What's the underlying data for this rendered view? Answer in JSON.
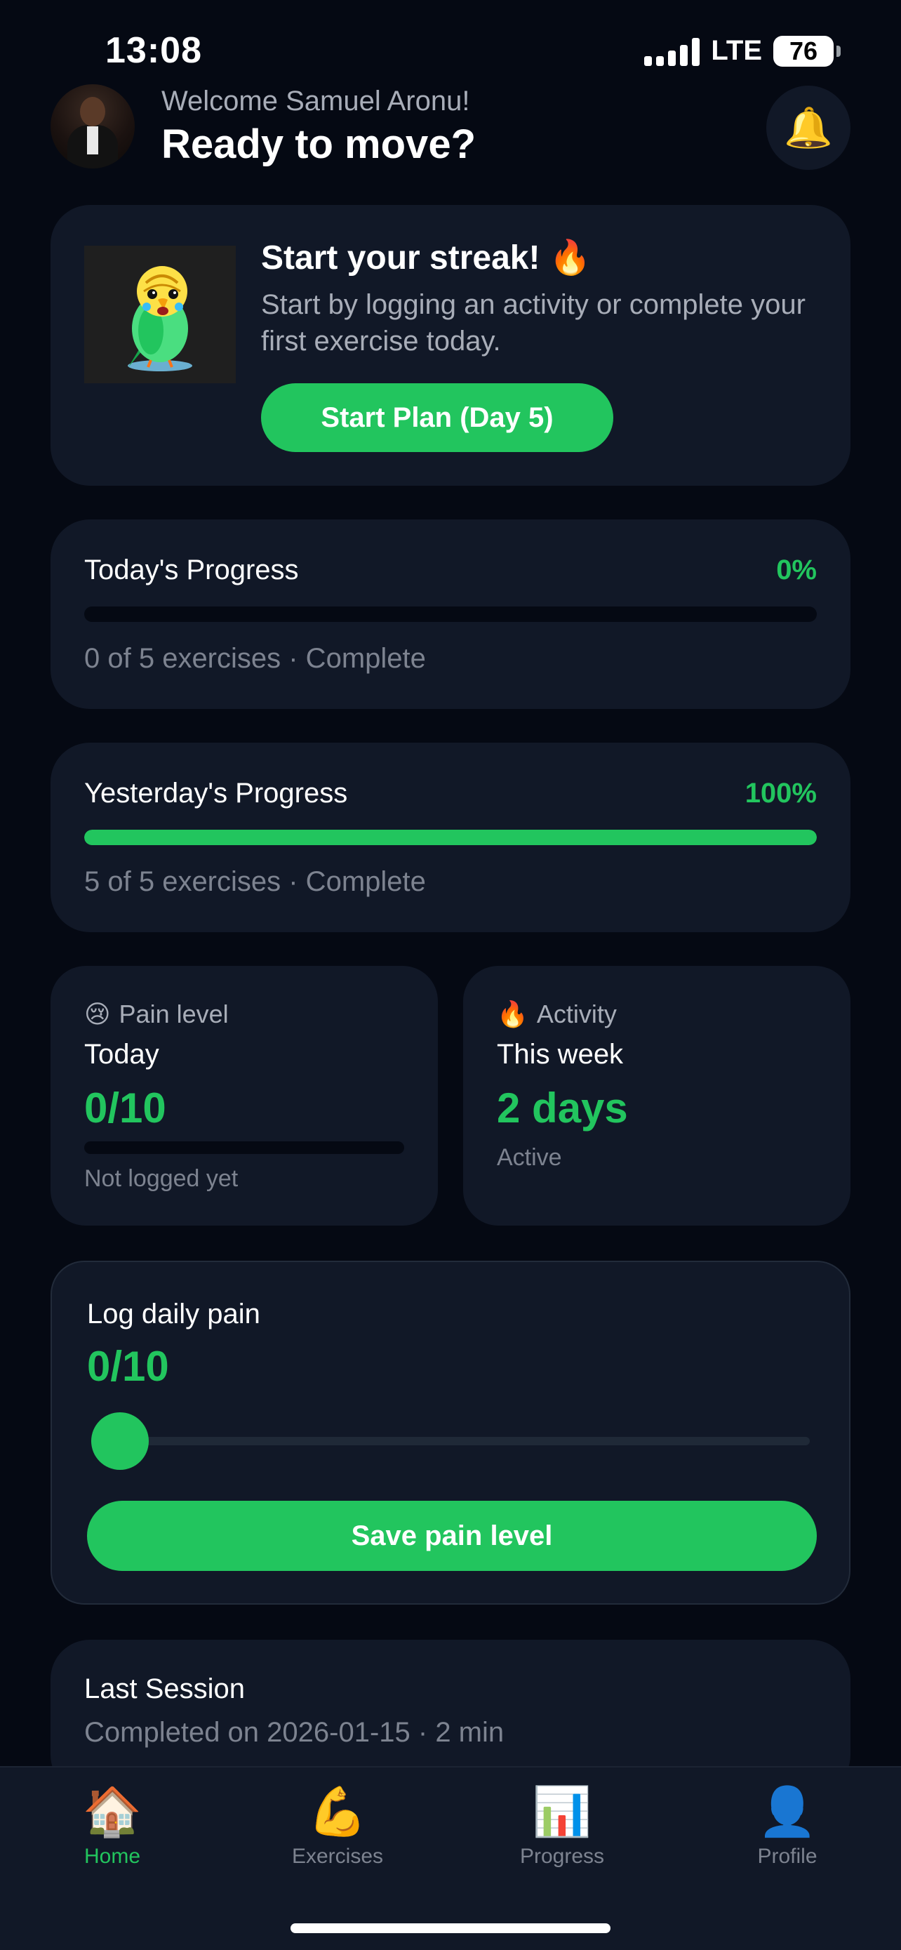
{
  "status_bar": {
    "time": "13:08",
    "network": "LTE",
    "battery": "76"
  },
  "header": {
    "welcome": "Welcome Samuel Aronu!",
    "headline": "Ready to move?",
    "bell_icon": "🔔"
  },
  "streak_card": {
    "title": "Start your streak! 🔥",
    "text": "Start by logging an activity or complete your first exercise today.",
    "button_label": "Start Plan (Day 5)"
  },
  "today_progress": {
    "title": "Today's Progress",
    "percent_label": "0%",
    "percent": 0,
    "summary": "0 of 5 exercises · Complete"
  },
  "yesterday_progress": {
    "title": "Yesterday's Progress",
    "percent_label": "100%",
    "percent": 100,
    "summary": "5 of 5 exercises · Complete"
  },
  "pain_card": {
    "emoji": "😢",
    "label": "Pain level",
    "period": "Today",
    "value": "0/10",
    "level": 0,
    "note": "Not logged yet"
  },
  "activity_card": {
    "emoji": "🔥",
    "label": "Activity",
    "period": "This week",
    "value": "2 days",
    "note": "Active"
  },
  "log_pain": {
    "title": "Log daily pain",
    "value": "0/10",
    "slider_value": 0,
    "slider_max": 10,
    "save_label": "Save pain level"
  },
  "last_session": {
    "title": "Last Session",
    "detail": "Completed on 2026-01-15 · 2 min"
  },
  "tabs": [
    {
      "icon": "🏠",
      "label": "Home",
      "active": true
    },
    {
      "icon": "💪",
      "label": "Exercises",
      "active": false
    },
    {
      "icon": "📊",
      "label": "Progress",
      "active": false
    },
    {
      "icon": "👤",
      "label": "Profile",
      "active": false
    }
  ],
  "colors": {
    "accent": "#22c55e",
    "background": "#050913",
    "card": "#111827"
  }
}
